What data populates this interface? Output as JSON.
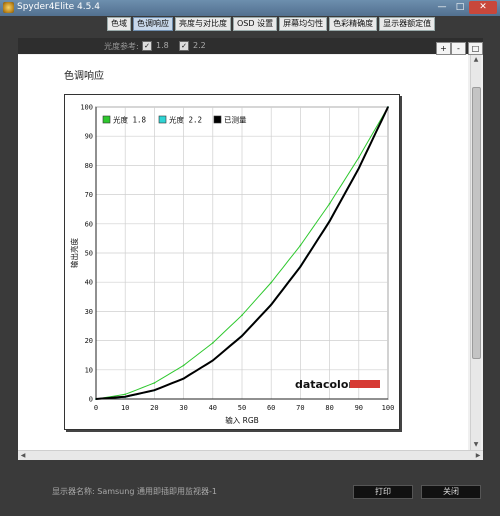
{
  "window": {
    "title": "Spyder4Elite 4.5.4",
    "minimize": "—",
    "maximize": "□",
    "close": "✕"
  },
  "tabs": [
    {
      "label": "色域",
      "active": false
    },
    {
      "label": "色调响应",
      "active": true
    },
    {
      "label": "亮度与对比度",
      "active": false
    },
    {
      "label": "OSD 设置",
      "active": false
    },
    {
      "label": "屏幕均匀性",
      "active": false
    },
    {
      "label": "色彩精确度",
      "active": false
    },
    {
      "label": "显示器额定值",
      "active": false
    }
  ],
  "toolbar": {
    "gamma_ref_label": "光度参考:",
    "options": [
      {
        "value": "1.8",
        "checked": true
      },
      {
        "value": "2.2",
        "checked": true
      }
    ],
    "check_mark": "✓",
    "zoom_in": "+",
    "zoom_out": "-",
    "zoom_fit": "□"
  },
  "page": {
    "title": "色调响应"
  },
  "scroll": {
    "up": "▲",
    "down": "▼",
    "left": "◀",
    "right": "▶"
  },
  "chart_data": {
    "type": "line",
    "xlabel": "输入 RGB",
    "ylabel": "输出亮度",
    "xlim": [
      0,
      100
    ],
    "ylim": [
      0,
      100
    ],
    "xticks": [
      0,
      10,
      20,
      30,
      40,
      50,
      60,
      70,
      80,
      90,
      100
    ],
    "yticks": [
      0,
      10,
      20,
      30,
      40,
      50,
      60,
      70,
      80,
      90,
      100
    ],
    "grid": true,
    "legend_position": "top-left",
    "x": [
      0,
      10,
      20,
      30,
      40,
      50,
      60,
      70,
      80,
      90,
      100
    ],
    "series": [
      {
        "name": "光度 1.8",
        "color": "#2ec82e",
        "values": [
          0,
          1.6,
          5.5,
          11.5,
          19.2,
          28.7,
          39.9,
          52.6,
          66.9,
          82.7,
          100
        ]
      },
      {
        "name": "光度 2.2",
        "color": "#2fd4d4",
        "values": [
          0,
          0.6,
          2.9,
          7.1,
          13.3,
          21.8,
          32.5,
          45.6,
          61.2,
          79.3,
          100
        ]
      },
      {
        "name": "已测量",
        "color": "#000000",
        "values": [
          0,
          0.8,
          3.0,
          7.0,
          13.2,
          21.6,
          32.3,
          45.3,
          60.9,
          79.0,
          100
        ]
      }
    ],
    "brand_logo": "datacolor"
  },
  "footer": {
    "display_name": "显示器名称: Samsung 通用即插即用监视器-1",
    "print_label": "打印",
    "close_label": "关闭"
  }
}
